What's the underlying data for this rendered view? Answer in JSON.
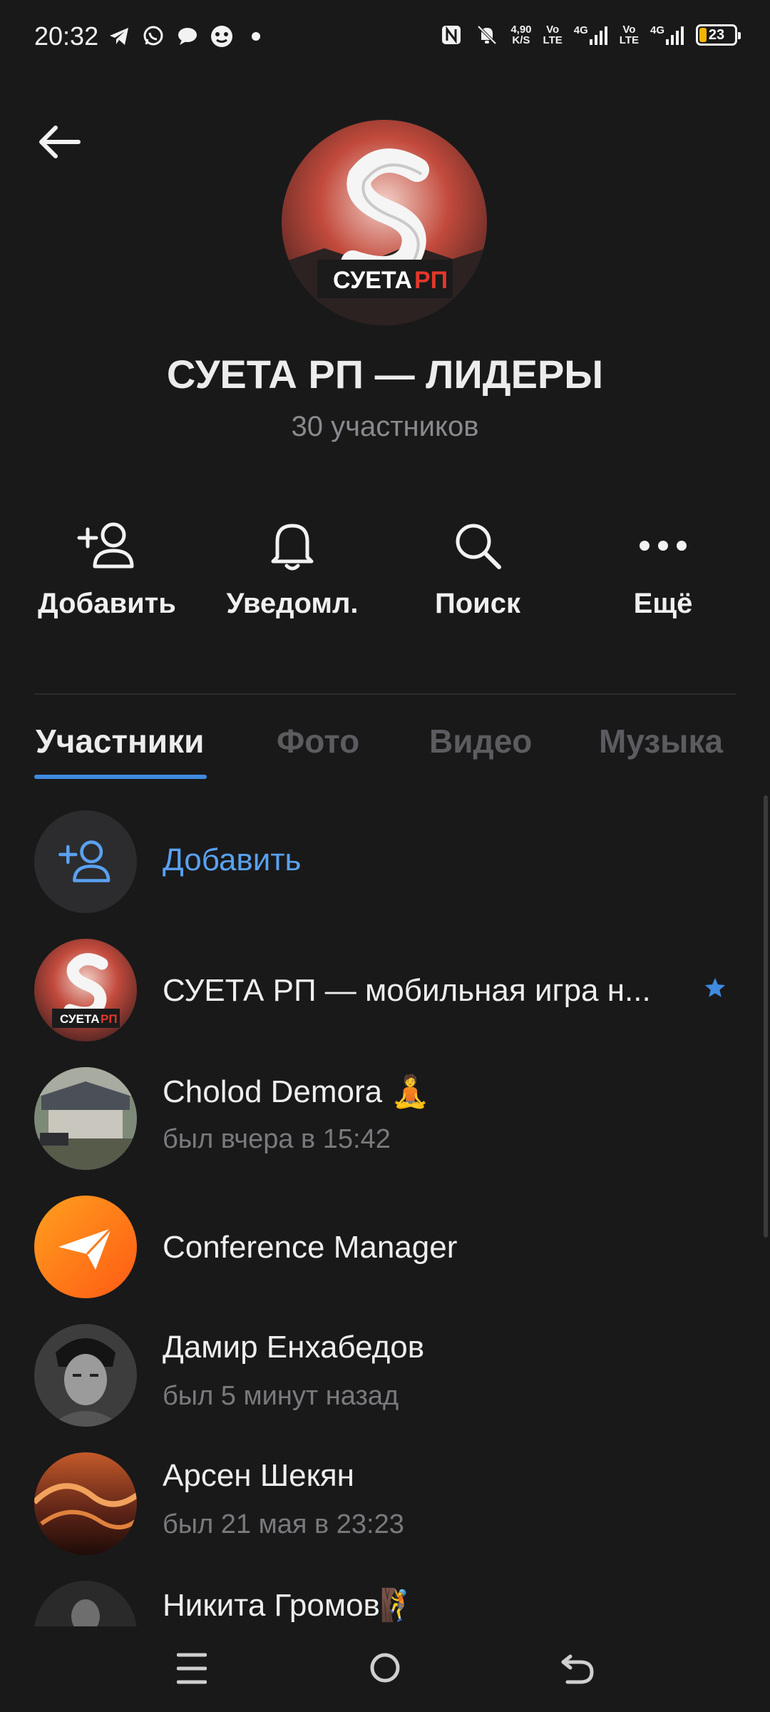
{
  "status_bar": {
    "time": "20:32",
    "net_speed_value": "4,90",
    "net_speed_unit": "K/S",
    "volte1": "Vo",
    "volte1_sub": "LTE",
    "net1": "4G",
    "volte2": "Vo",
    "volte2_sub": "LTE",
    "net2": "4G",
    "battery": "23",
    "icons": [
      "telegram-icon",
      "whatsapp-icon",
      "message-icon",
      "bot-icon",
      "dot-icon",
      "nfc-icon",
      "bell-muted-icon",
      "signal-icon",
      "signal-icon",
      "battery-icon"
    ]
  },
  "header": {
    "title": "СУЕТА РП — ЛИДЕРЫ",
    "subtitle": "30 участников",
    "avatar_text_white": "СУЕТА",
    "avatar_text_red": "РП"
  },
  "actions": [
    {
      "label": "Добавить",
      "icon": "add-user-icon"
    },
    {
      "label": "Уведомл.",
      "icon": "bell-icon"
    },
    {
      "label": "Поиск",
      "icon": "search-icon"
    },
    {
      "label": "Ещё",
      "icon": "more-icon"
    }
  ],
  "tabs": [
    {
      "label": "Участники",
      "active": true
    },
    {
      "label": "Фото",
      "active": false
    },
    {
      "label": "Видео",
      "active": false
    },
    {
      "label": "Музыка",
      "active": false
    }
  ],
  "members": {
    "add_label": "Добавить",
    "list": [
      {
        "name": "СУЕТА РП — мобильная игра н...",
        "status": "",
        "starred": true,
        "avatar_text_white": "СУЕТА",
        "avatar_text_red": "РП"
      },
      {
        "name": "Cholod Demora 🧘",
        "status": "был вчера в 15:42"
      },
      {
        "name": "Conference Manager",
        "status": ""
      },
      {
        "name": "Дамир Енхабедов",
        "status": "был 5 минут назад"
      },
      {
        "name": "Арсен Шекян",
        "status": "был 21 мая в 23:23"
      },
      {
        "name": "Никита Громов🧗",
        "status": ""
      }
    ]
  },
  "colors": {
    "background": "#19191a",
    "accent": "#3f8ae0",
    "link": "#5aa1f0"
  }
}
